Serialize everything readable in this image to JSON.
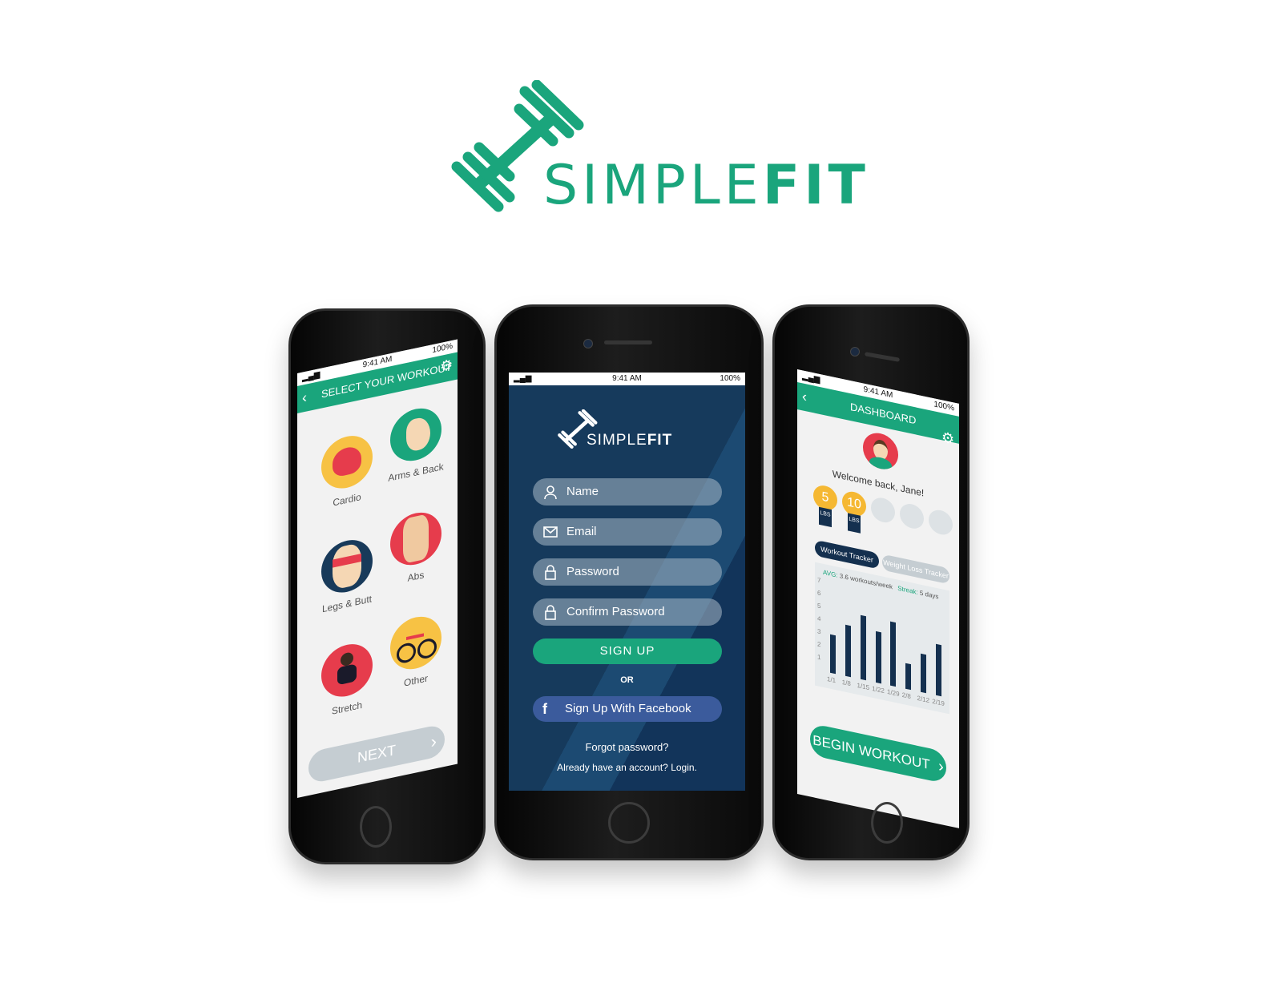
{
  "brand": {
    "name_thin": "SIMPLE",
    "name_bold": "FIT",
    "color": "#1aa57c",
    "icon": "barbell-icon"
  },
  "status_bar": {
    "time": "9:41 AM",
    "battery": "100%"
  },
  "left_phone": {
    "header_title": "SELECT YOUR WORKOUT",
    "header_color": "#1aa57c",
    "workouts": [
      {
        "label": "Cardio",
        "icon": "heart-icon"
      },
      {
        "label": "Arms & Back",
        "icon": "bicep-icon"
      },
      {
        "label": "Legs & Butt",
        "icon": "legs-icon"
      },
      {
        "label": "Abs",
        "icon": "abs-icon"
      },
      {
        "label": "Stretch",
        "icon": "stretch-icon"
      },
      {
        "label": "Other",
        "icon": "bicycle-icon"
      }
    ],
    "next_label": "NEXT"
  },
  "center_phone": {
    "logo_thin": "SIMPLE",
    "logo_bold": "FIT",
    "fields": {
      "name": "Name",
      "email": "Email",
      "password": "Password",
      "confirm_password": "Confirm Password"
    },
    "signup_label": "SIGN UP",
    "or_label": "OR",
    "facebook_label": "Sign Up With Facebook",
    "forgot_label": "Forgot password?",
    "login_label": "Already have an account? Login.",
    "background_color": "#163a5c"
  },
  "right_phone": {
    "header_title": "DASHBOARD",
    "welcome": "Welcome back, Jane!",
    "medals": [
      {
        "value": "5",
        "unit": "LBS",
        "earned": true
      },
      {
        "value": "10",
        "unit": "LBS",
        "earned": true
      },
      {
        "value": "",
        "unit": "",
        "earned": false
      },
      {
        "value": "",
        "unit": "",
        "earned": false
      },
      {
        "value": "",
        "unit": "",
        "earned": false
      }
    ],
    "tabs": {
      "workout": "Workout Tracker",
      "weight": "Weight Loss Tracker"
    },
    "avg_label": "AVG:",
    "avg_value": "3.6 workouts/week",
    "streak_label": "Streak:",
    "streak_value": "5 days",
    "begin_label": "BEGIN WORKOUT",
    "chart_data": {
      "type": "bar",
      "categories": [
        "1/1",
        "1/8",
        "1/15",
        "1/22",
        "1/29",
        "2/8",
        "2/12",
        "2/19"
      ],
      "values": [
        3,
        4,
        5,
        4,
        5,
        2,
        3,
        4
      ],
      "ylim": [
        0,
        7
      ],
      "yticks": [
        "1",
        "2",
        "3",
        "4",
        "5",
        "6",
        "7"
      ],
      "bar_color": "#14304f",
      "grid": false
    }
  }
}
